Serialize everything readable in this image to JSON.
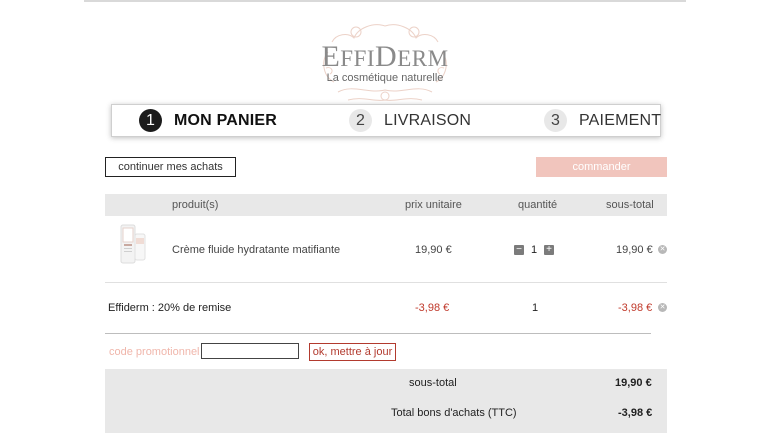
{
  "brand": {
    "name_first": "E",
    "name_rest_small": "FFI",
    "name_mid": "D",
    "name_end_small": "ERM",
    "tagline": "La cosmétique naturelle"
  },
  "steps": [
    {
      "number": "1",
      "label": "MON PANIER",
      "state": "active"
    },
    {
      "number": "2",
      "label": "LIVRAISON",
      "state": "inactive"
    },
    {
      "number": "3",
      "label": "PAIEMENT",
      "state": "inactive"
    }
  ],
  "actions": {
    "continue_label": "continuer mes achats",
    "order_label": "commander"
  },
  "table": {
    "headers": {
      "product": "produit(s)",
      "unit_price": "prix unitaire",
      "quantity": "quantité",
      "subtotal": "sous-total"
    },
    "product_row": {
      "name": "Crème fluide hydratante matifiante",
      "unit_price": "19,90 €",
      "quantity": "1",
      "minus": "−",
      "plus": "+",
      "subtotal": "19,90 €",
      "remove": "✕"
    },
    "discount_row": {
      "name": "Effiderm : 20% de remise",
      "unit_price": "-3,98 €",
      "quantity": "1",
      "subtotal": "-3,98 €",
      "remove": "✕"
    }
  },
  "promo": {
    "label": "code promotionnel",
    "value": "",
    "button_label": "ok, mettre à jour"
  },
  "totals": {
    "subtotal_label": "sous-total",
    "subtotal_value": "19,90 €",
    "vouchers_label": "Total bons d'achats (TTC)",
    "vouchers_value": "-3,98 €"
  },
  "colors": {
    "accent_pink": "#f1c5bd",
    "discount_red": "#c0392b",
    "promo_red": "#b23a2e"
  }
}
